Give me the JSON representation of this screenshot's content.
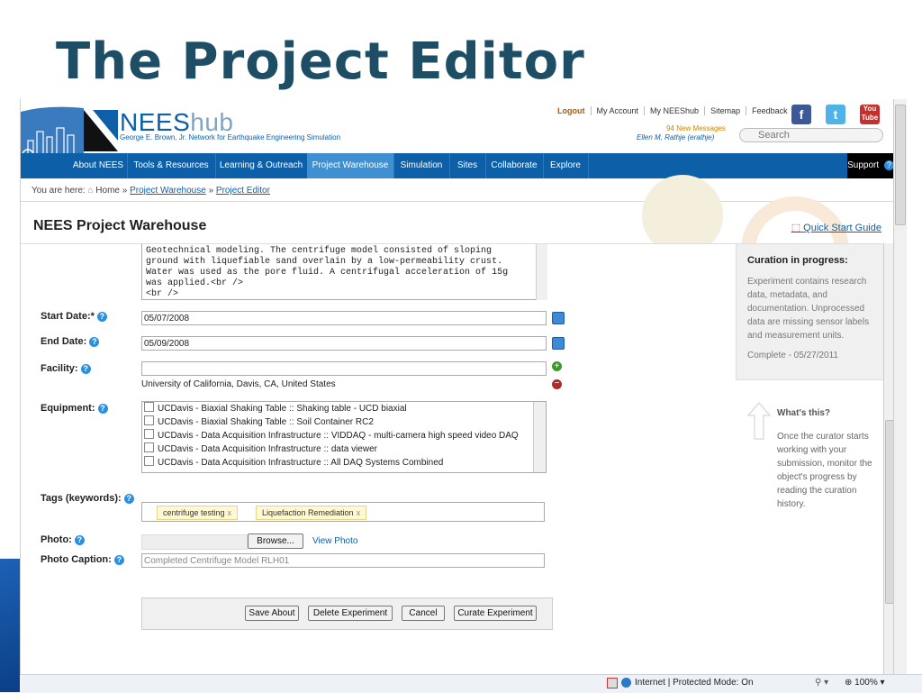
{
  "slide": {
    "title": "The Project Editor"
  },
  "header": {
    "brand_main": "NEES",
    "brand_hub": "hub",
    "brand_sub": "George E. Brown, Jr. Network for Earthquake Engineering Simulation",
    "links": [
      "Logout",
      "My Account",
      "My NEEShub",
      "Sitemap",
      "Feedback"
    ],
    "messages": "94 New Messages",
    "user": "Ellen M. Rathje (erathje)",
    "search_placeholder": "Search",
    "social": [
      "facebook-icon",
      "twitter-icon",
      "youtube-icon"
    ]
  },
  "nav": {
    "items": [
      "About NEES",
      "Tools & Resources",
      "Learning & Outreach",
      "Project Warehouse",
      "Simulation",
      "Sites",
      "Collaborate",
      "Explore"
    ],
    "active": "Project Warehouse",
    "support": "Support"
  },
  "breadcrumb": {
    "prefix": "You are here:",
    "home": "Home",
    "sep": "»",
    "items": [
      "Project Warehouse",
      "Project Editor"
    ]
  },
  "page": {
    "title": "NEES Project Warehouse",
    "quick_start": "Quick Start Guide"
  },
  "form": {
    "description_text": "Geotechnical modeling. The centrifuge model consisted of sloping\nground with liquefiable sand overlain by a low-permeability crust.\nWater was used as the pore fluid. A centrifugal acceleration of 15g\nwas applied.<br />\n<br />\nThere were three treatment areas within the model - one untreated",
    "start_date_label": "Start Date:*",
    "start_date": "05/07/2008",
    "end_date_label": "End Date:",
    "end_date": "05/09/2008",
    "facility_label": "Facility:",
    "facility_value": "University of California, Davis, CA, United States",
    "equipment_label": "Equipment:",
    "equipment": [
      "UCDavis - Biaxial Shaking Table :: Shaking table - UCD biaxial",
      "UCDavis - Biaxial Shaking Table :: Soil Container RC2",
      "UCDavis - Data Acquisition Infrastructure :: VIDDAQ - multi-camera high speed video DAQ",
      "UCDavis - Data Acquisition Infrastructure :: data viewer",
      "UCDavis - Data Acquisition Infrastructure :: All DAQ Systems Combined"
    ],
    "tags_label": "Tags (keywords):",
    "tags": [
      "centrifuge testing",
      "Liquefaction Remediation"
    ],
    "photo_label": "Photo:",
    "browse": "Browse...",
    "view_photo": "View Photo",
    "caption_label": "Photo Caption:",
    "caption_value": "Completed Centrifuge Model RLH01",
    "buttons": [
      "Save About",
      "Delete Experiment",
      "Cancel",
      "Curate Experiment"
    ]
  },
  "sidebar": {
    "curation_title": "Curation in progress:",
    "curation_body": "Experiment contains research data, metadata, and documentation. Unprocessed data are missing sensor labels and measurement units.",
    "complete": "Complete - 05/27/2011",
    "whats_this": "What's this?",
    "whats_body": "Once the curator starts working with your submission, monitor the object's progress by reading the curation history."
  },
  "statusbar": {
    "zone": "Internet | Protected Mode: On",
    "zoom": "100%"
  },
  "colors": {
    "title": "#1d4e66",
    "nav": "#0d5fa8",
    "nav_active": "#3f8fd1",
    "link": "#0d5fa8",
    "messages": "#d08400"
  }
}
